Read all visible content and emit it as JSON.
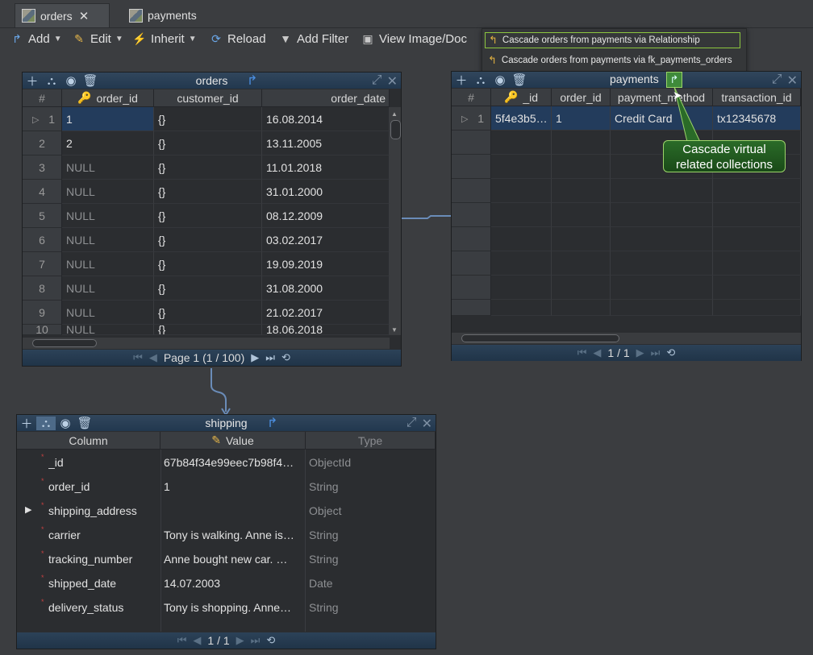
{
  "tabs": [
    {
      "label": "orders",
      "active": true
    },
    {
      "label": "payments",
      "active": false
    }
  ],
  "toolbar": {
    "add": "Add",
    "edit": "Edit",
    "inherit": "Inherit",
    "reload": "Reload",
    "add_filter": "Add Filter",
    "view_image": "View Image/Doc"
  },
  "popup": {
    "items": [
      "Cascade orders from payments via Relationship",
      "Cascade orders from payments via fk_payments_orders"
    ]
  },
  "orders": {
    "title": "orders",
    "columns": [
      "#",
      "order_id",
      "customer_id",
      "order_date"
    ],
    "rows": [
      {
        "n": "1",
        "order_id": "1",
        "customer_id": "{}",
        "order_date": "16.08.2014"
      },
      {
        "n": "2",
        "order_id": "2",
        "customer_id": "{}",
        "order_date": "13.11.2005"
      },
      {
        "n": "3",
        "order_id": "NULL",
        "customer_id": "{}",
        "order_date": "11.01.2018"
      },
      {
        "n": "4",
        "order_id": "NULL",
        "customer_id": "{}",
        "order_date": "31.01.2000"
      },
      {
        "n": "5",
        "order_id": "NULL",
        "customer_id": "{}",
        "order_date": "08.12.2009"
      },
      {
        "n": "6",
        "order_id": "NULL",
        "customer_id": "{}",
        "order_date": "03.02.2017"
      },
      {
        "n": "7",
        "order_id": "NULL",
        "customer_id": "{}",
        "order_date": "19.09.2019"
      },
      {
        "n": "8",
        "order_id": "NULL",
        "customer_id": "{}",
        "order_date": "31.08.2000"
      },
      {
        "n": "9",
        "order_id": "NULL",
        "customer_id": "{}",
        "order_date": "21.02.2017"
      },
      {
        "n": "10",
        "order_id": "NULL",
        "customer_id": "{}",
        "order_date": "18.06.2018"
      }
    ],
    "pager": "Page 1 (1 / 100)"
  },
  "payments": {
    "title": "payments",
    "columns": [
      "#",
      "_id",
      "order_id",
      "payment_method",
      "transaction_id"
    ],
    "rows": [
      {
        "n": "1",
        "_id": "5f4e3b5…",
        "order_id": "1",
        "payment_method": "Credit Card",
        "transaction_id": "tx12345678"
      }
    ],
    "pager": "1 / 1"
  },
  "tooltip": {
    "line1": "Cascade virtual",
    "line2": "related collections"
  },
  "shipping": {
    "title": "shipping",
    "columns": [
      "Column",
      "Value",
      "Type"
    ],
    "fields": [
      {
        "name": "_id",
        "value": "67b84f34e99eec7b98f4…",
        "type": "ObjectId",
        "expandable": false
      },
      {
        "name": "order_id",
        "value": "1",
        "type": "String",
        "expandable": false
      },
      {
        "name": "shipping_address",
        "value": "",
        "type": "Object",
        "expandable": true
      },
      {
        "name": "carrier",
        "value": "Tony is walking. Anne is…",
        "type": "String",
        "expandable": false
      },
      {
        "name": "tracking_number",
        "value": "Anne bought new car. …",
        "type": "String",
        "expandable": false
      },
      {
        "name": "shipped_date",
        "value": "14.07.2003",
        "type": "Date",
        "expandable": false
      },
      {
        "name": "delivery_status",
        "value": "Tony is shopping. Anne…",
        "type": "String",
        "expandable": false
      }
    ],
    "pager": "1 / 1"
  },
  "colors": {
    "accent_selection": "#233c5c",
    "tooltip_bg": "#2a6b28",
    "header_bg": "#31465c"
  }
}
